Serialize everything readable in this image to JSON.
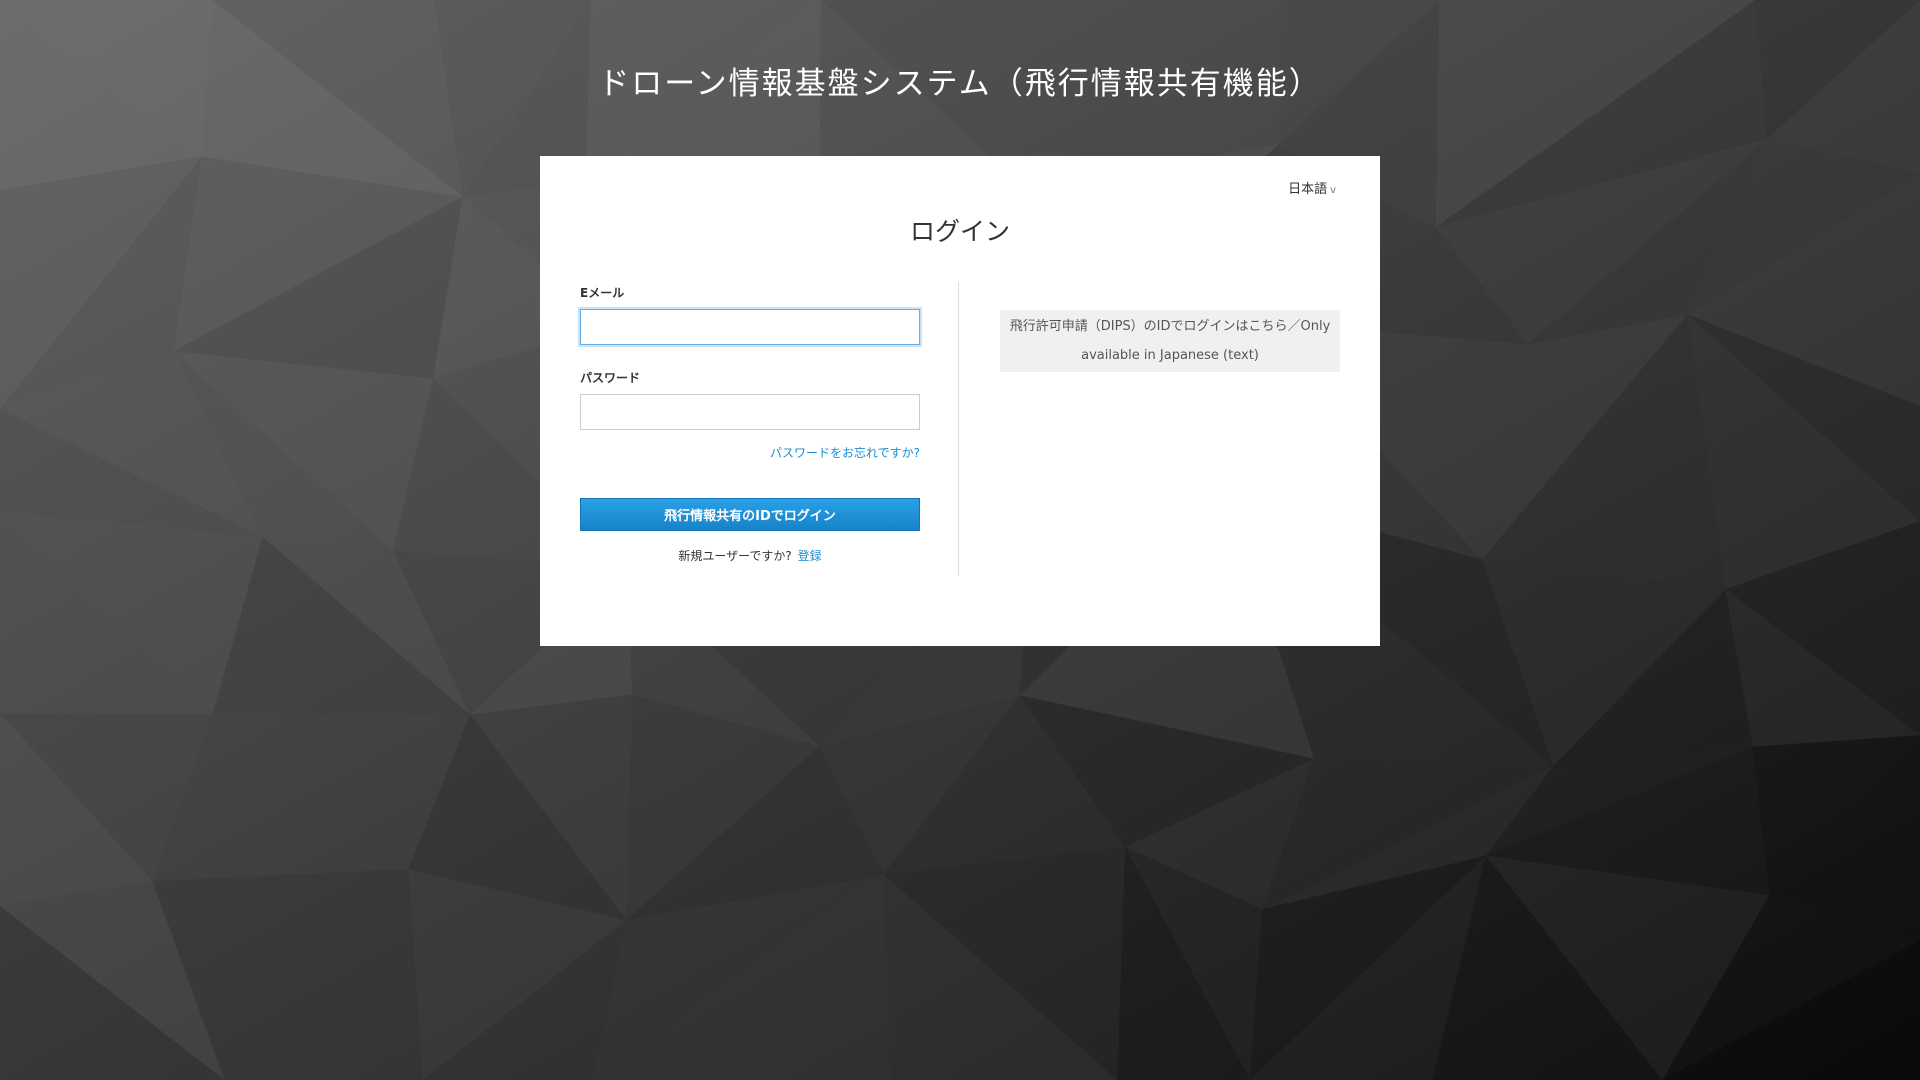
{
  "site_title": "ドローン情報基盤システム（飛行情報共有機能）",
  "language_selector": {
    "value": "日本語",
    "chevron": "v"
  },
  "login": {
    "heading": "ログイン",
    "email_label": "Eメール",
    "email_value": "",
    "password_label": "パスワード",
    "password_value": "",
    "forgot_password": "パスワードをお忘れですか?",
    "submit_label": "飛行情報共有のIDでログイン",
    "new_user_text": "新規ユーザーですか?",
    "register_link": "登録"
  },
  "dips_login": {
    "line1": "飛行許可申請（DIPS）のIDでログインはこちら／Only",
    "line2": "available in Japanese (text)"
  },
  "colors": {
    "accent": "#1a8fd1",
    "button": "#1783c9",
    "background_dark": "#1e1e1e",
    "background_light": "#6e6e6e"
  }
}
